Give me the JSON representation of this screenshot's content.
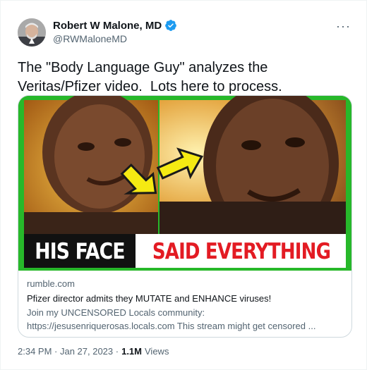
{
  "author": {
    "name": "Robert W Malone, MD",
    "handle": "@RWMaloneMD"
  },
  "icons": {
    "verified": "verified-badge-icon",
    "more": "more-options-icon"
  },
  "colors": {
    "verified": "#1d9bf0",
    "thumbnail_border": "#27b82a",
    "headline_red": "#e31b23",
    "arrow_yellow": "#f5ea12"
  },
  "tweet": {
    "text": "The \"Body Language Guy\" analyzes the Veritas/Pfizer video.  Lots here to process."
  },
  "card": {
    "thumbnail": {
      "headline_left": "HIS FACE",
      "headline_right": "SAID EVERYTHING"
    },
    "domain": "rumble.com",
    "title": "Pfizer director admits they MUTATE and ENHANCE viruses!",
    "description_line1": "Join my UNCENSORED Locals community:",
    "description_line2": "https://jesusenriquerosas.locals.com This stream might get censored ..."
  },
  "footer": {
    "timestamp": "2:34 PM · Jan 27, 2023 ·",
    "views_count": "1.1M",
    "views_label": "Views"
  }
}
